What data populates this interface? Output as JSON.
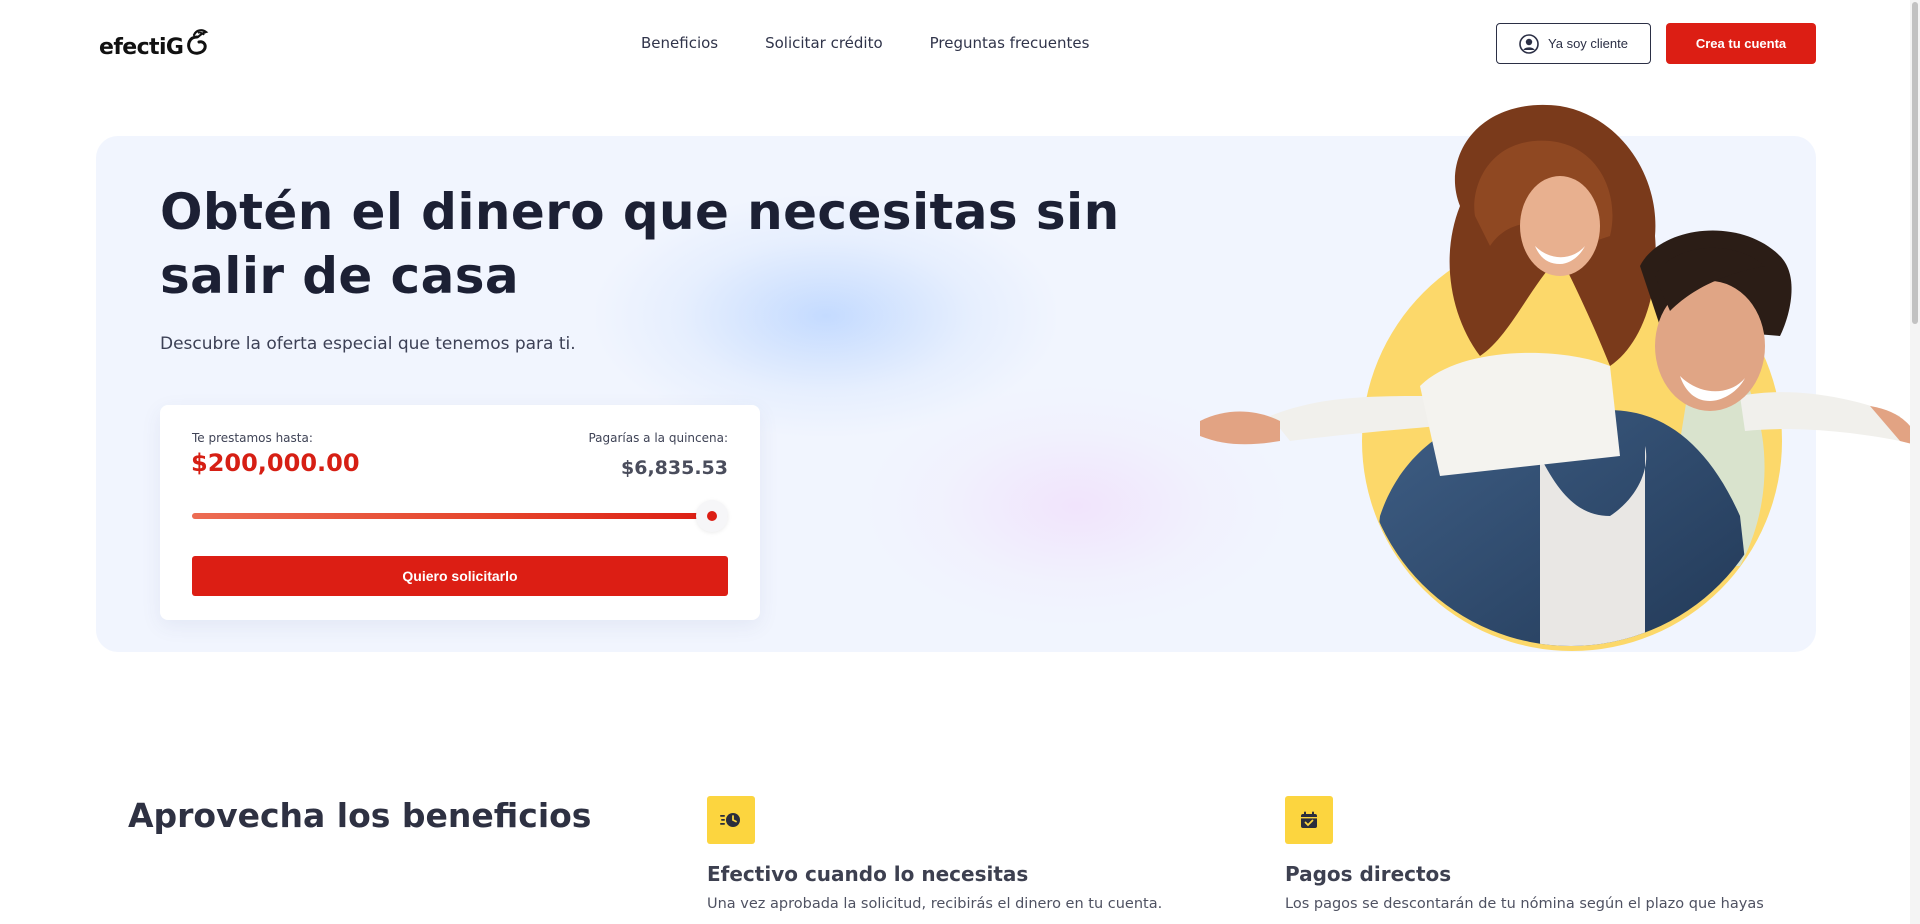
{
  "brand": {
    "logo_text": "efectiG",
    "accent_color": "#dc1e14",
    "benefit_icon_bg": "#fcd53f"
  },
  "nav": {
    "items": [
      {
        "label": "Beneficios"
      },
      {
        "label": "Solicitar crédito"
      },
      {
        "label": "Preguntas frecuentes"
      }
    ]
  },
  "header": {
    "client_button": "Ya soy cliente",
    "client_icon": "user-circle-icon",
    "create_button": "Crea tu cuenta"
  },
  "hero": {
    "title": "Obtén el dinero que necesitas sin salir de casa",
    "subtitle": "Descubre la oferta especial que tenemos para ti."
  },
  "calculator": {
    "loan_label": "Te prestamos hasta:",
    "loan_amount": "$200,000.00",
    "payment_label": "Pagarías a la quincena:",
    "payment_amount": "$6,835.53",
    "slider_fraction": 0.97,
    "cta": "Quiero solicitarlo"
  },
  "benefits": {
    "title": "Aprovecha los beneficios",
    "items": [
      {
        "icon": "fast-clock-icon",
        "title": "Efectivo cuando lo necesitas",
        "text": "Una vez aprobada la solicitud, recibirás el dinero en tu cuenta."
      },
      {
        "icon": "calendar-check-icon",
        "title": "Pagos directos",
        "text": "Los pagos se descontarán de tu nómina según el plazo que hayas"
      }
    ]
  }
}
